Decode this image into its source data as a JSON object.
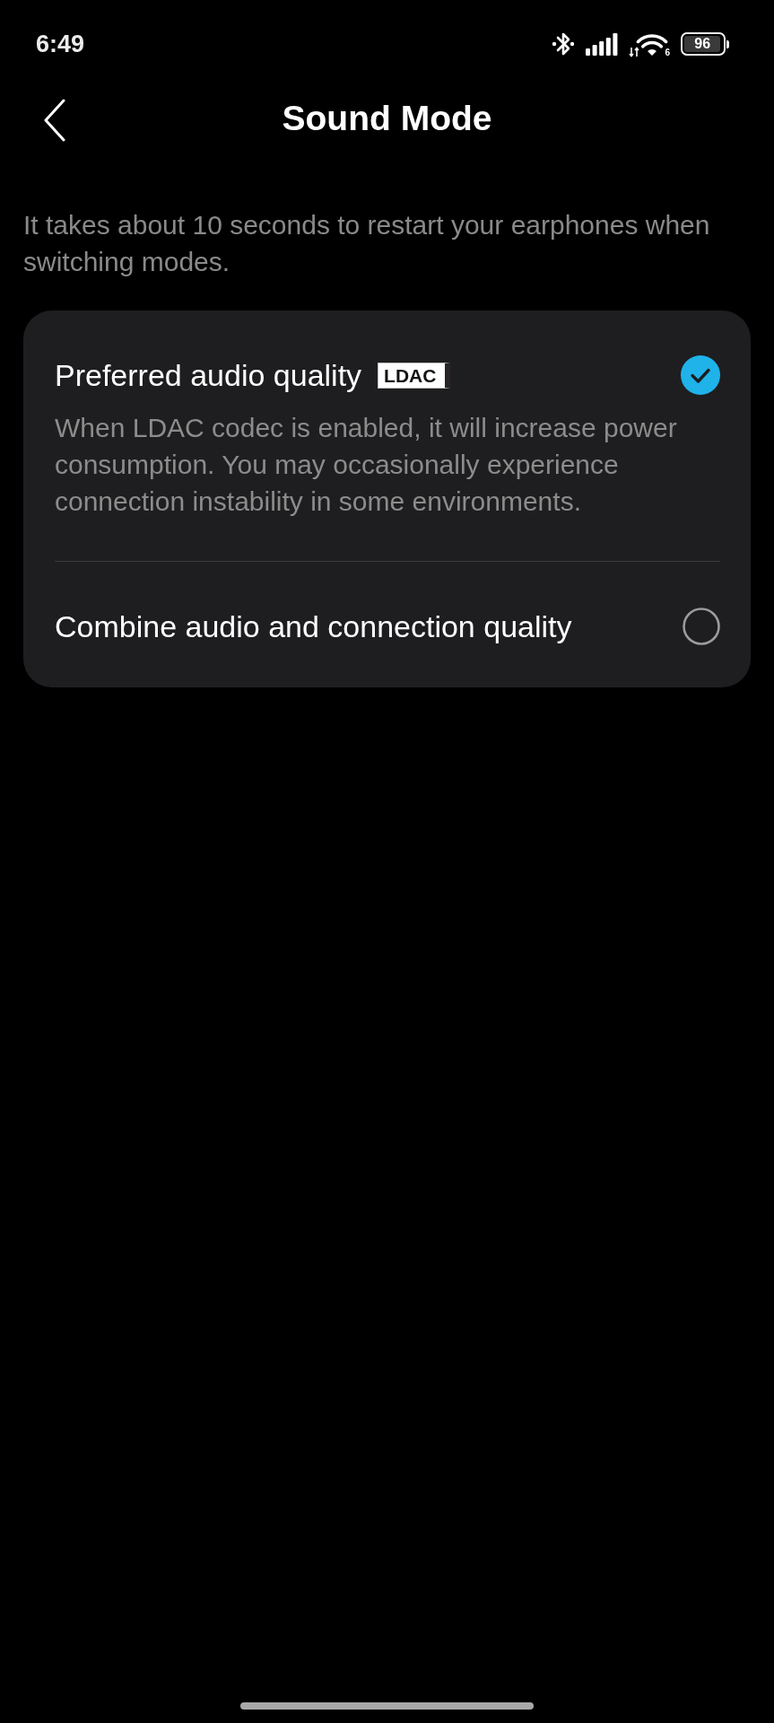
{
  "status_bar": {
    "time": "6:49",
    "wifi_label": "6",
    "battery": "96"
  },
  "header": {
    "title": "Sound Mode"
  },
  "notice": "It takes about 10 seconds to restart your earphones when switching modes.",
  "options": [
    {
      "title": "Preferred audio quality",
      "badge": "LDAC",
      "description": "When LDAC codec is enabled, it will increase power consumption. You may occasionally experience connection instability in some environments.",
      "selected": true
    },
    {
      "title": "Combine audio and connection quality",
      "selected": false
    }
  ]
}
